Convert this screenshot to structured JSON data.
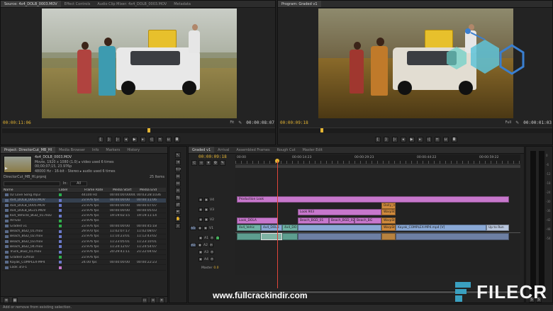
{
  "source_monitor": {
    "tabs": [
      "Source: 4x4_DOLB_0003.MOV",
      "Effect Controls",
      "Audio Clip Mixer: 4x4_DOLB_0003.MOV",
      "Metadata"
    ],
    "timecode_left": "00:00:11:06",
    "timecode_right": "00:00:08:07",
    "fit": "Fit"
  },
  "program_monitor": {
    "tabs": [
      "Program: Graded v1"
    ],
    "timecode_left": "00:00:09:18",
    "timecode_right": "00:00:01:03",
    "fit": "Full"
  },
  "project_panel": {
    "tabs": [
      "Project: DirectorCut_MB_HI",
      "Media Browser",
      "Info",
      "Markers",
      "History"
    ],
    "clip_name": "4x4_DOLB_0003.MOV",
    "clip_info_1": "Movie, 1920 x 1080 (1.0) ▸ video used 6 times",
    "clip_info_2": "00;00;07;15, 23.976p",
    "clip_info_3": "48000 Hz - 16-bit - Stereo ▸ audio used 6 times",
    "project_name": "DirectorCut_MB_HI.prproj",
    "items_count": "25 Items",
    "in_label": "In:",
    "in_value": "All",
    "columns": [
      "Name",
      "Label",
      "Frame Rate",
      "Media Start",
      "Media End"
    ],
    "rows": [
      {
        "name": "02 Love Song.mp3",
        "label_color": "#29b04f",
        "rate": "44100 Hz",
        "start": "00:00:00:00000",
        "end": "00:03:28:1036"
      },
      {
        "name": "4x4_DOLB_0003.MOV",
        "label_color": "#6a78c9",
        "rate": "23.976 fps",
        "start": "00:00:00:00",
        "end": "00:00:11:06"
      },
      {
        "name": "4x4_DOLB_0005.MOV",
        "label_color": "#6a78c9",
        "rate": "23.976 fps",
        "start": "00:00:00:00",
        "end": "00:00:07:07"
      },
      {
        "name": "4x4_DOLB_BG15.MOV",
        "label_color": "#6a78c9",
        "rate": "23.976 fps",
        "start": "00:00:00:00",
        "end": "00:00:05:03"
      },
      {
        "name": "4x4_Vehicle_BGD_01.mov",
        "label_color": "#6a78c9",
        "rate": "23.976 fps",
        "start": "19:19:02:15",
        "end": "19:19:11:14"
      },
      {
        "name": "Arrival",
        "label_color": "#2fae4a",
        "rate": "23.976 fps",
        "start": "",
        "end": ""
      },
      {
        "name": "Graded v1",
        "label_color": "#2fae4a",
        "rate": "23.976 fps",
        "start": "00:00:00:00",
        "end": "00:00:45:18"
      },
      {
        "name": "Beach_BGD_01.mov",
        "label_color": "#6a78c9",
        "rate": "29.970 fps",
        "start": "11:02:07:17",
        "end": "11:02:08:07"
      },
      {
        "name": "Beach_BGD_02.mov",
        "label_color": "#6a78c9",
        "rate": "23.976 fps",
        "start": "11:10:23:01",
        "end": "11:12:43:02"
      },
      {
        "name": "Beach_BGD_03.mov",
        "label_color": "#6a78c9",
        "rate": "23.976 fps",
        "start": "11:23:05:01",
        "end": "11:23:10:01"
      },
      {
        "name": "Beach_BGD_04.mov",
        "label_color": "#6a78c9",
        "rate": "23.976 fps",
        "start": "11:24:12:07",
        "end": "11:24:54:07"
      },
      {
        "name": "Truck_BGD_01.mov",
        "label_color": "#6a78c9",
        "rate": "23.976 fps",
        "start": "20:29:41:11",
        "end": "21:22:04:02"
      },
      {
        "name": "Graded v2final",
        "label_color": "#2fae4a",
        "rate": "23.976 fps",
        "start": "",
        "end": ""
      },
      {
        "name": "Kayak_COMPLEX-MP4",
        "label_color": "#6a78c9",
        "rate": "24.00 fps",
        "start": "00:00:00:00",
        "end": "00:00:22:23"
      },
      {
        "name": "Look 3/3-1",
        "label_color": "#c777cc",
        "rate": "",
        "start": "",
        "end": ""
      }
    ]
  },
  "timeline": {
    "tabs": [
      "Graded v1",
      "Arrival",
      "Assembled Frames",
      "Rough Cut",
      "Master Edit"
    ],
    "timecode": "00:00:09:18",
    "ruler_labels": [
      "00:00",
      "00:00:14:23",
      "00:00:29:23",
      "00:00:44:22",
      "00:00:59:22"
    ],
    "tracks": [
      {
        "id": "V4",
        "name": ""
      },
      {
        "id": "V3",
        "name": ""
      },
      {
        "id": "V2",
        "name": ""
      },
      {
        "id": "V1",
        "name": "V1"
      },
      {
        "id": "A1",
        "name": "A1"
      },
      {
        "id": "A2",
        "name": ""
      },
      {
        "id": "A3",
        "name": ""
      },
      {
        "id": "A4",
        "name": ""
      }
    ],
    "master_label": "Master",
    "master_value": "0.0",
    "clips": {
      "production_look": "Production Look",
      "look_903": "Look 903",
      "dolly_in": "Dolly_In",
      "look_dola": "Look_DOLA",
      "beach_bgd_01": "Beach_BGD_01",
      "beach_bgd_02": "Beach_BGD_02",
      "beach_bgd_03": "Beach_BG",
      "v1_clip_a": "4x4_Vehic",
      "v1_clip_b": "4x4_DOLB",
      "v1_clip_c": "4x4_DO",
      "kayak": "Kayak_COMPLEX-MP4.mp4 [V]",
      "up_to_run": "Up to Run",
      "warp_1": "WarpSt",
      "warp_2": "WarpSt",
      "warp_3": "WarpSt"
    }
  },
  "status_text": "Add or remove from existing selection.",
  "watermark": {
    "url": "www.fullcrackindir.com",
    "brand": "FILECR"
  },
  "colors": {
    "accent_timecode": "#e4b433",
    "playhead": "#e0463a"
  }
}
